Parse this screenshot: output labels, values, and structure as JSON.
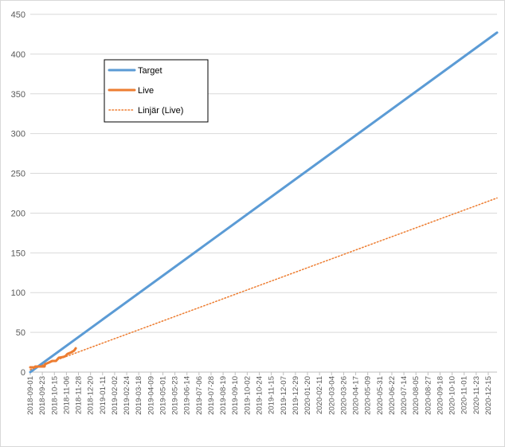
{
  "chart_data": {
    "type": "line",
    "title": "",
    "xlabel": "",
    "ylabel": "",
    "ylim": [
      0,
      450
    ],
    "yticks": [
      0,
      50,
      100,
      150,
      200,
      250,
      300,
      350,
      400,
      450
    ],
    "grid": "horizontal",
    "legend_position": "upper-left",
    "x_tick_labels": [
      "2018-09-01",
      "2018-09-23",
      "2018-10-15",
      "2018-11-06",
      "2018-11-28",
      "2018-12-20",
      "2019-01-11",
      "2019-02-02",
      "2019-02-24",
      "2019-03-18",
      "2019-04-09",
      "2019-05-01",
      "2019-05-23",
      "2019-06-14",
      "2019-07-06",
      "2019-07-28",
      "2019-08-19",
      "2019-09-10",
      "2019-10-02",
      "2019-10-24",
      "2019-11-15",
      "2019-12-07",
      "2019-12-29",
      "2020-01-20",
      "2020-02-11",
      "2020-03-04",
      "2020-03-26",
      "2020-04-17",
      "2020-05-09",
      "2020-05-31",
      "2020-06-22",
      "2020-07-14",
      "2020-08-05",
      "2020-08-27",
      "2020-09-18",
      "2020-10-10",
      "2020-11-01",
      "2020-11-23",
      "2020-12-15"
    ],
    "x_range": [
      "2018-09-01",
      "2020-12-31"
    ],
    "series": [
      {
        "name": "Target",
        "style": "solid",
        "color": "#5b9bd5",
        "points": [
          [
            "2018-09-01",
            0
          ],
          [
            "2020-12-31",
            427
          ]
        ]
      },
      {
        "name": "Live",
        "style": "solid",
        "color": "#ed7d31",
        "points": [
          [
            "2018-09-01",
            6
          ],
          [
            "2018-09-09",
            6
          ],
          [
            "2018-09-10",
            7
          ],
          [
            "2018-09-20",
            7
          ],
          [
            "2018-09-27",
            7
          ],
          [
            "2018-09-28",
            10
          ],
          [
            "2018-10-05",
            12
          ],
          [
            "2018-10-11",
            14
          ],
          [
            "2018-10-18",
            14
          ],
          [
            "2018-10-23",
            18
          ],
          [
            "2018-10-31",
            19
          ],
          [
            "2018-11-04",
            20
          ],
          [
            "2018-11-08",
            23
          ],
          [
            "2018-11-15",
            25
          ],
          [
            "2018-11-20",
            27
          ],
          [
            "2018-11-23",
            30
          ]
        ]
      },
      {
        "name": "Linjär (Live)",
        "style": "dotted",
        "color": "#ed7d31",
        "points": [
          [
            "2018-09-01",
            3
          ],
          [
            "2020-12-31",
            219
          ]
        ]
      }
    ]
  }
}
